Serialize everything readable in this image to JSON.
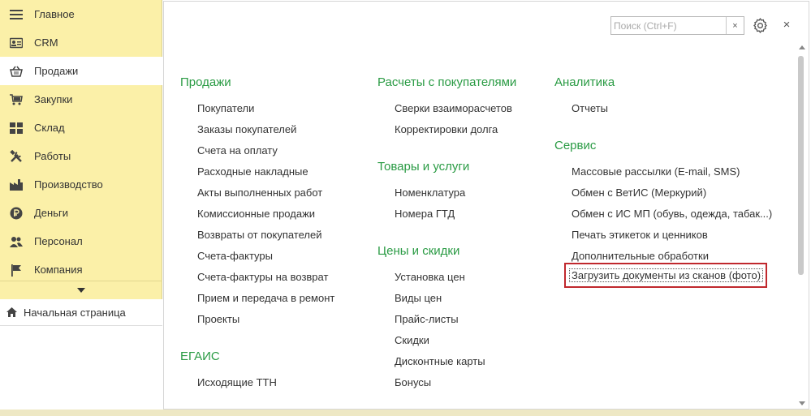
{
  "sidebar": {
    "items": [
      {
        "label": "Главное",
        "icon": "menu-icon"
      },
      {
        "label": "CRM",
        "icon": "crm-card-icon"
      },
      {
        "label": "Продажи",
        "icon": "basket-icon"
      },
      {
        "label": "Закупки",
        "icon": "cart-icon"
      },
      {
        "label": "Склад",
        "icon": "warehouse-grid-icon"
      },
      {
        "label": "Работы",
        "icon": "tools-icon"
      },
      {
        "label": "Производство",
        "icon": "factory-icon"
      },
      {
        "label": "Деньги",
        "icon": "ruble-coin-icon"
      },
      {
        "label": "Персонал",
        "icon": "people-icon"
      },
      {
        "label": "Компания",
        "icon": "flag-icon"
      }
    ],
    "active_index": 2,
    "home_label": "Начальная страница"
  },
  "toolbar": {
    "search_placeholder": "Поиск (Ctrl+F)",
    "search_value": "",
    "clear_label": "×",
    "close_label": "×"
  },
  "columns": {
    "col1": {
      "sections": [
        {
          "title": "Продажи",
          "links": [
            "Покупатели",
            "Заказы покупателей",
            "Счета на оплату",
            "Расходные накладные",
            "Акты выполненных работ",
            "Комиссионные продажи",
            "Возвраты от покупателей",
            "Счета-фактуры",
            "Счета-фактуры на возврат",
            "Прием и передача в ремонт",
            "Проекты"
          ]
        },
        {
          "title": "ЕГАИС",
          "links": [
            "Исходящие ТТН"
          ]
        }
      ]
    },
    "col2": {
      "sections": [
        {
          "title": "Расчеты с покупателями",
          "links": [
            "Сверки взаиморасчетов",
            "Корректировки долга"
          ]
        },
        {
          "title": "Товары и услуги",
          "links": [
            "Номенклатура",
            "Номера ГТД"
          ]
        },
        {
          "title": "Цены и скидки",
          "links": [
            "Установка цен",
            "Виды цен",
            "Прайс-листы",
            "Скидки",
            "Дисконтные карты",
            "Бонусы"
          ]
        }
      ]
    },
    "col3": {
      "sections": [
        {
          "title": "Аналитика",
          "links": [
            "Отчеты"
          ]
        },
        {
          "title": "Сервис",
          "links": [
            "Массовые рассылки (E-mail, SMS)",
            "Обмен с ВетИС (Меркурий)",
            "Обмен с ИС МП (обувь, одежда, табак...)",
            "Печать этикеток и ценников",
            "Дополнительные обработки"
          ]
        }
      ],
      "highlighted_link": "Загрузить документы из сканов (фото)"
    }
  },
  "colors": {
    "sidebar_bg": "#fbf0a8",
    "section_heading": "#2a9b44",
    "highlight_border": "#c0282d"
  }
}
